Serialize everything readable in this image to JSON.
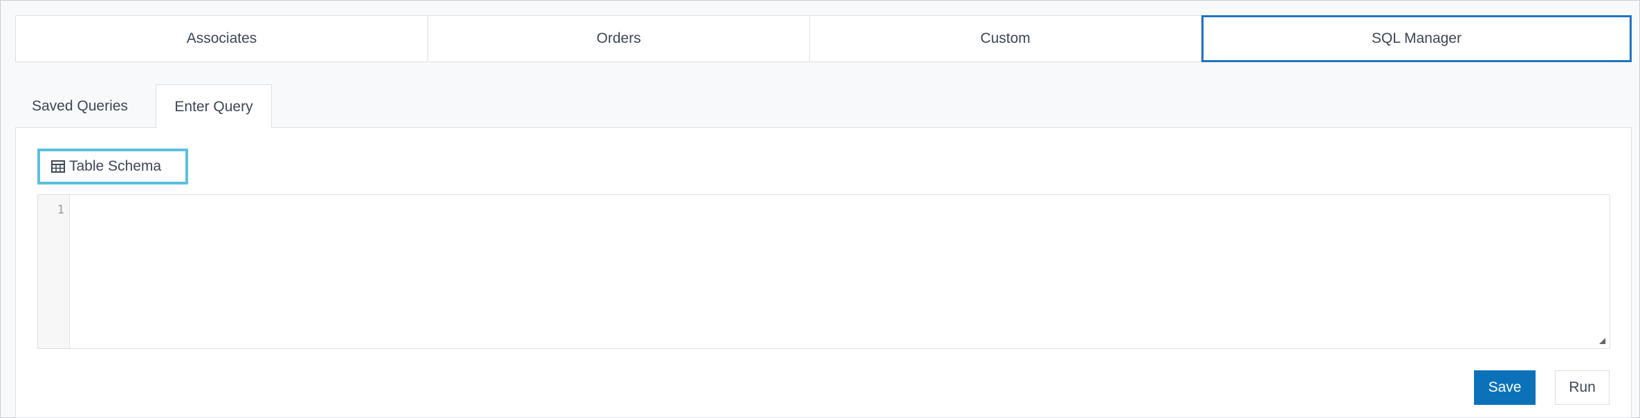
{
  "top_tabs": [
    {
      "label": "Associates",
      "active": false
    },
    {
      "label": "Orders",
      "active": false
    },
    {
      "label": "Custom",
      "active": false
    },
    {
      "label": "SQL Manager",
      "active": true
    }
  ],
  "sub_tabs": [
    {
      "label": "Saved Queries",
      "active": false
    },
    {
      "label": "Enter Query",
      "active": true
    }
  ],
  "schema_button": {
    "label": "Table Schema",
    "icon": "table-icon"
  },
  "editor": {
    "line_numbers": [
      "1"
    ],
    "value": ""
  },
  "actions": {
    "save_label": "Save",
    "run_label": "Run"
  },
  "colors": {
    "accent": "#1f74c1",
    "primary_button": "#0b72b9",
    "focus_outline": "#5bc0de"
  }
}
